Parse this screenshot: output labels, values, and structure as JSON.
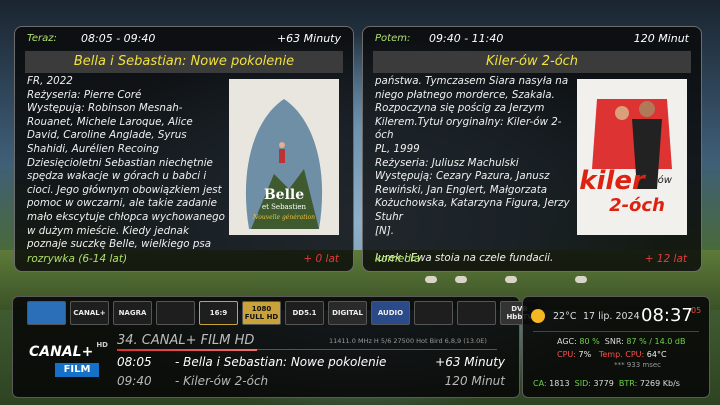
{
  "now_panel": {
    "label": "Teraz:",
    "time": "08:05 - 09:40",
    "remaining": "+63 Minuty",
    "title": "Bella i Sebastian: Nowe pokolenie",
    "description": "FR, 2022\nReżyseria: Pierre Coré\nWystępują: Robinson Mesnah-Rouanet, Michele Laroque, Alice David, Caroline Anglade, Syrus Shahidi, Aurélien Recoing\nDziesięcioletni Sebastian niechętnie spędza wakacje w górach u babci i cioci. Jego głównym obowiązkiem jest pomoc w owczarni, ale takie zadanie mało ekscytuje chłopca wychowanego w dużym mieście. Kiedy jednak poznaje suczkę Belle, wielkiego psa",
    "genre": "rozrywka (6-14 lat)",
    "age": "+ 0 lat",
    "poster_title": "Belle",
    "poster_sub": "et Sebastien",
    "poster_tag": "Nouvelle génération"
  },
  "next_panel": {
    "label": "Potem:",
    "time": "09:40 - 11:40",
    "remaining": "120 Minut",
    "title": "Kiler-ów 2-óch",
    "description": "państwa. Tymczasem Siara nasyła na niego płatnego morderce, Szakala. Rozpoczyna się pościg za Jerzym Kilerem.Tytuł oryginalny: Kiler-ów 2-óch\nPL, 1999\nReżyseria: Juliusz Machulski\nWystępują: Cezary Pazura, Janusz Rewiński, Jan Englert, Małgorzata Kożuchowska, Katarzyna Figura, Jerzy Stuhr\n[N].\n\nJurek i Ewa stoją na czele fundacji,",
    "genre": "komedia",
    "age": "+ 12 lat",
    "poster_title": "kiler",
    "poster_sub1": "-ów",
    "poster_sub2": "2-óch"
  },
  "infobar": {
    "icons": [
      "",
      "CANAL+",
      "NAGRA",
      "",
      "16:9",
      "1080 FULL HD",
      "DD5.1",
      "DIGITAL",
      "AUDIO",
      "",
      "",
      "DVB HbbTV"
    ],
    "channel_logo": "CANAL+",
    "channel_logo_hd": "HD",
    "channel_logo_film": "FILM",
    "channel": "34. CANAL+ FILM HD",
    "transponder": "11411.0 MHz  H  5/6  27500  Hot Bird 6,8,9 (13.0E)",
    "now": {
      "time": "08:05",
      "name": "-  Bella i Sebastian: Nowe pokolenie",
      "dur": "+63 Minuty"
    },
    "next": {
      "time": "09:40",
      "name": "-  Kiler-ów 2-óch",
      "dur": "120 Minut"
    }
  },
  "status": {
    "temp": "22°C",
    "date": "17 lip. 2024",
    "clock": "08:37",
    "secs": "05",
    "agc_label": "AGC:",
    "agc": "80 %",
    "snr_label": "SNR:",
    "snr": "87 % / 14.0 dB",
    "cpu_label": "CPU:",
    "cpu": "7%",
    "tcpu_label": "Temp. CPU:",
    "tcpu": "64°C",
    "ms": "*** 933 msec",
    "ca_label": "CA:",
    "ca": "1813",
    "sid_label": "SID:",
    "sid": "3779",
    "btr_label": "BTR:",
    "btr": "7269 Kb/s"
  },
  "colors": {
    "accent_green": "#aee06a",
    "title_yellow": "#f2e23a",
    "alert_red": "#e23c3c"
  }
}
